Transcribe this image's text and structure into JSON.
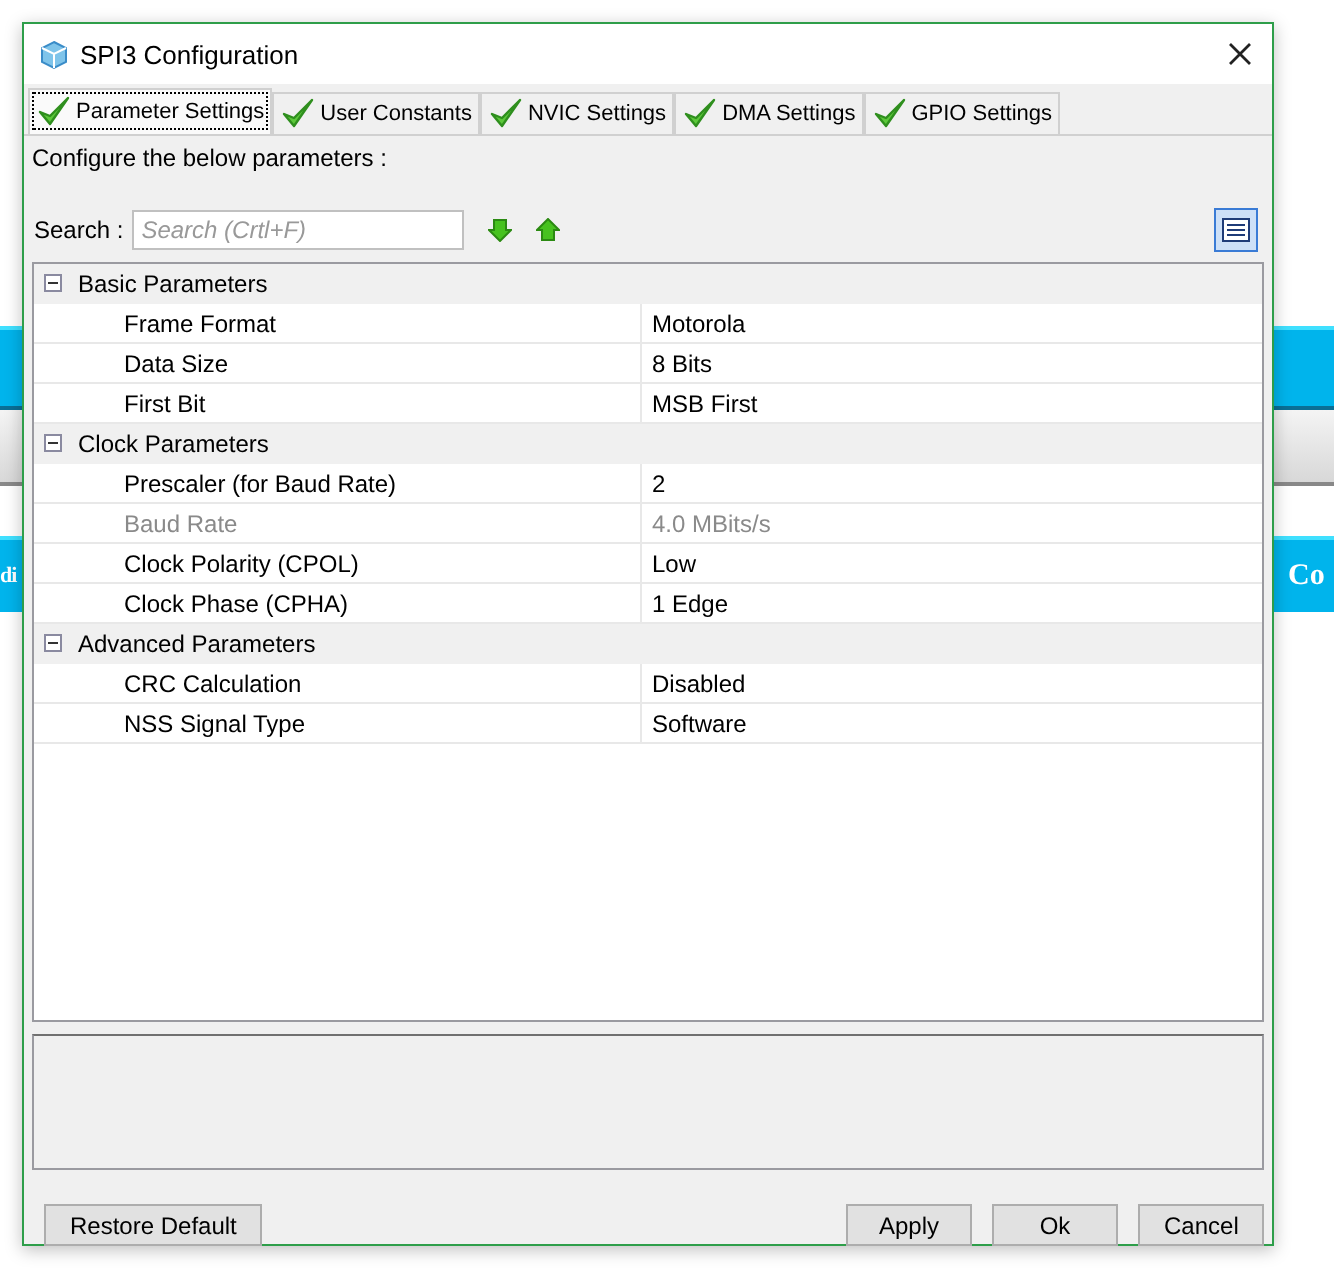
{
  "background": {
    "left_label": "di",
    "right_label": "Co"
  },
  "window": {
    "title": "SPI3 Configuration"
  },
  "tabs": [
    {
      "label": "Parameter Settings",
      "selected": true
    },
    {
      "label": "User Constants",
      "selected": false
    },
    {
      "label": "NVIC Settings",
      "selected": false
    },
    {
      "label": "DMA Settings",
      "selected": false
    },
    {
      "label": "GPIO Settings",
      "selected": false
    }
  ],
  "instruction": "Configure the below parameters :",
  "search": {
    "label": "Search :",
    "placeholder": "Search (Crtl+F)"
  },
  "groups": [
    {
      "name": "Basic Parameters",
      "expanded": true,
      "params": [
        {
          "name": "Frame Format",
          "value": "Motorola",
          "disabled": false
        },
        {
          "name": "Data Size",
          "value": "8 Bits",
          "disabled": false
        },
        {
          "name": "First Bit",
          "value": "MSB First",
          "disabled": false
        }
      ]
    },
    {
      "name": "Clock Parameters",
      "expanded": true,
      "params": [
        {
          "name": "Prescaler (for Baud Rate)",
          "value": "2",
          "disabled": false
        },
        {
          "name": "Baud Rate",
          "value": "4.0 MBits/s",
          "disabled": true
        },
        {
          "name": "Clock Polarity (CPOL)",
          "value": "Low",
          "disabled": false
        },
        {
          "name": "Clock Phase (CPHA)",
          "value": "1 Edge",
          "disabled": false
        }
      ]
    },
    {
      "name": "Advanced Parameters",
      "expanded": true,
      "params": [
        {
          "name": "CRC Calculation",
          "value": "Disabled",
          "disabled": false
        },
        {
          "name": "NSS Signal Type",
          "value": "Software",
          "disabled": false
        }
      ]
    }
  ],
  "buttons": {
    "left": [
      "Restore Default"
    ],
    "right": [
      "Apply",
      "Ok",
      "Cancel"
    ]
  }
}
